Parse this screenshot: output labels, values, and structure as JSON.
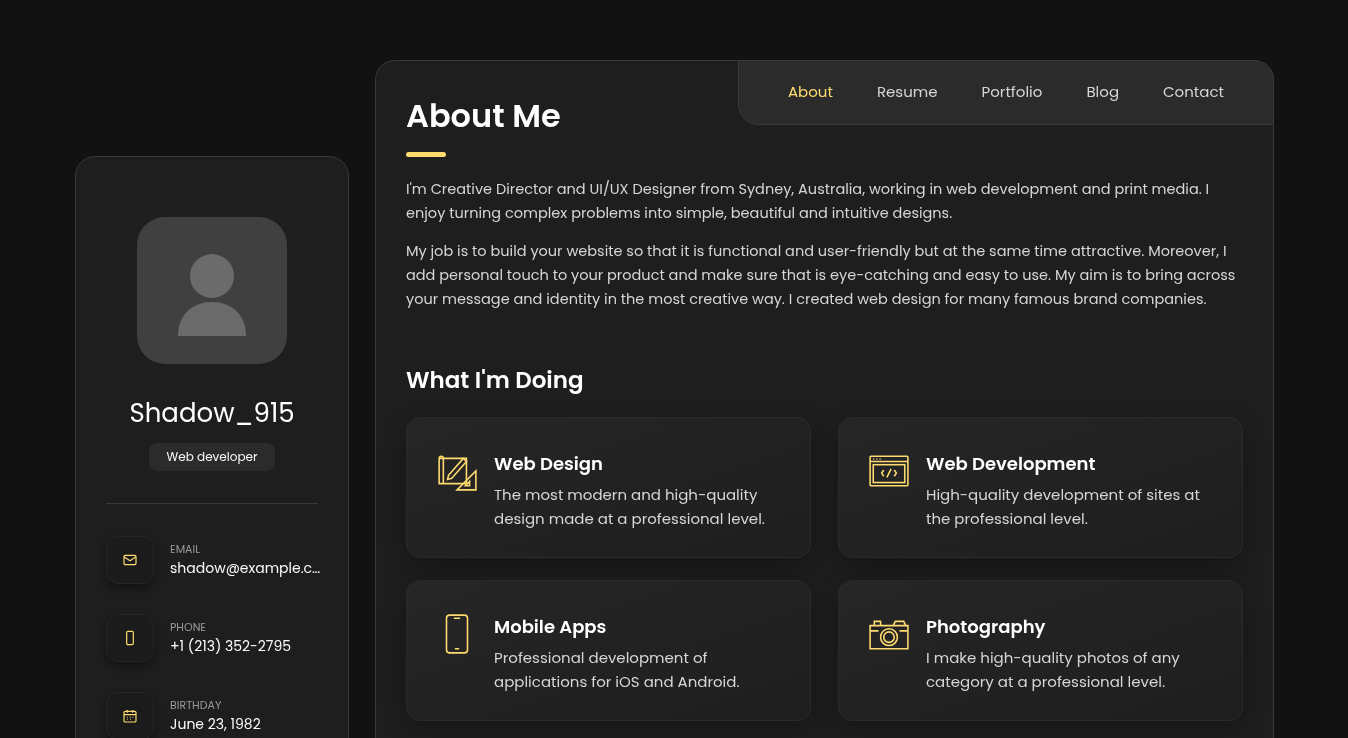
{
  "profile": {
    "name": "Shadow_915",
    "role": "Web developer"
  },
  "contacts": [
    {
      "kind": "email",
      "label": "EMAIL",
      "value": "shadow@example.c…"
    },
    {
      "kind": "phone",
      "label": "PHONE",
      "value": "+1 (213) 352-2795"
    },
    {
      "kind": "birthday",
      "label": "BIRTHDAY",
      "value": "June 23, 1982"
    }
  ],
  "nav": [
    {
      "label": "About",
      "selected": true
    },
    {
      "label": "Resume",
      "selected": false
    },
    {
      "label": "Portfolio",
      "selected": false
    },
    {
      "label": "Blog",
      "selected": false
    },
    {
      "label": "Contact",
      "selected": false
    }
  ],
  "title": "About Me",
  "paragraphs": [
    "I'm Creative Director and UI/UX Designer from Sydney, Australia, working in web development and print media. I enjoy turning complex problems into simple, beautiful and intuitive designs.",
    "My job is to build your website so that it is functional and user-friendly but at the same time attractive. Moreover, I add personal touch to your product and make sure that is eye-catching and easy to use. My aim is to bring across your message and identity in the most creative way. I created web design for many famous brand companies."
  ],
  "services_title": "What I'm Doing",
  "services": [
    {
      "kind": "design",
      "title": "Web Design",
      "text": "The most modern and high-quality design made at a professional level."
    },
    {
      "kind": "code",
      "title": "Web Development",
      "text": "High-quality development of sites at the professional level."
    },
    {
      "kind": "mobile",
      "title": "Mobile Apps",
      "text": "Professional development of applications for iOS and Android."
    },
    {
      "kind": "camera",
      "title": "Photography",
      "text": "I make high-quality photos of any category at a professional level."
    }
  ]
}
